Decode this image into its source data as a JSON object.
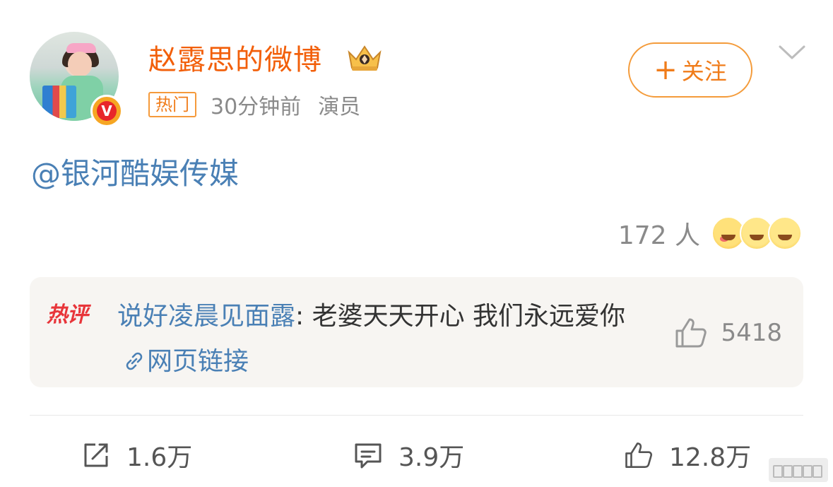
{
  "post": {
    "username": "赵露思的微博",
    "hot_tag": "热门",
    "time": "30分钟前",
    "role": "演员",
    "follow_label": "关注",
    "follow_plus": "+",
    "mention": "@银河酷娱传媒",
    "reaction_count": "172 人"
  },
  "hot_comment": {
    "badge": "热评",
    "author": "说好凌晨见面露",
    "separator": ": ",
    "text": "老婆天天开心 我们永远爱你",
    "link_label": "网页链接",
    "like_count": "5418"
  },
  "actions": {
    "share_count": "1.6万",
    "comment_count": "3.9万",
    "like_count": "12.8万"
  },
  "colors": {
    "username": "#f25f0a",
    "accent_orange": "#f07c1a",
    "link_blue": "#4a80b5",
    "muted_gray": "#8a8a8a"
  }
}
